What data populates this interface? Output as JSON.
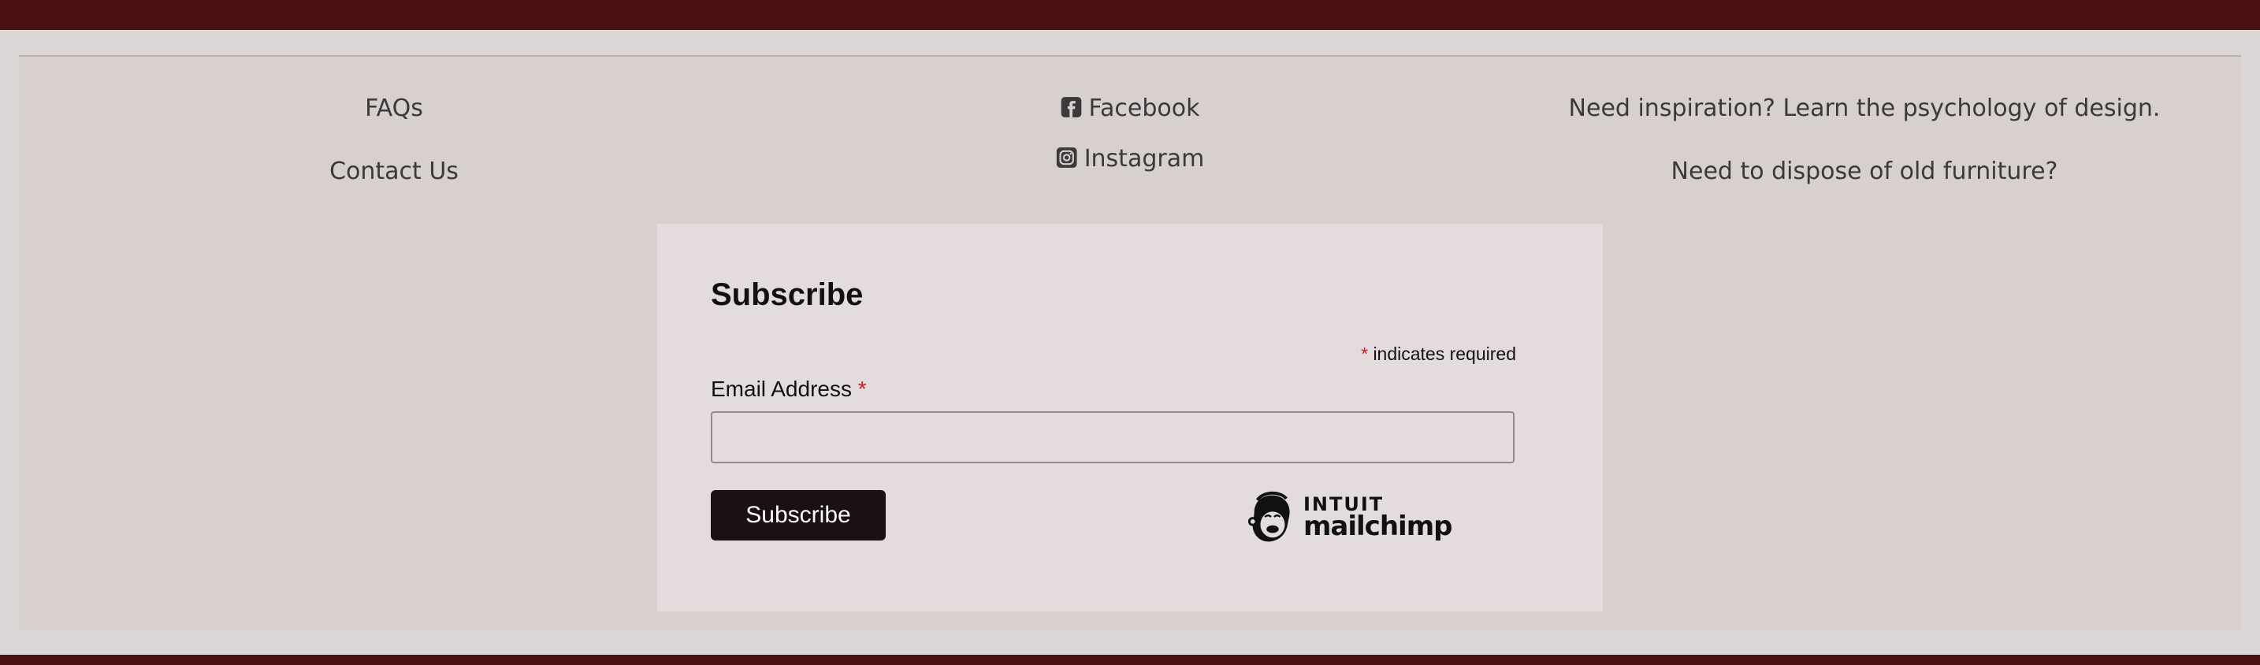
{
  "footer": {
    "left_links": [
      "FAQs",
      "Contact Us"
    ],
    "social": [
      {
        "label": "Facebook",
        "icon": "facebook-icon"
      },
      {
        "label": "Instagram",
        "icon": "instagram-icon"
      }
    ],
    "right_links": [
      "Need inspiration? Learn the psychology of design.",
      "Need to dispose of old furniture?"
    ]
  },
  "subscribe": {
    "title": "Subscribe",
    "required_marker": "*",
    "required_note": "indicates required",
    "email_label": "Email Address",
    "email_value": "",
    "button_label": "Subscribe",
    "brand_line1": "INTUIT",
    "brand_line2": "mailchimp",
    "brand_icon": "mailchimp-freddie-icon"
  },
  "colors": {
    "bar": "#4a1012",
    "panel": "#d8cfcf",
    "card": "#e4dbdc",
    "button": "#1c1112",
    "required": "#c0221f"
  }
}
